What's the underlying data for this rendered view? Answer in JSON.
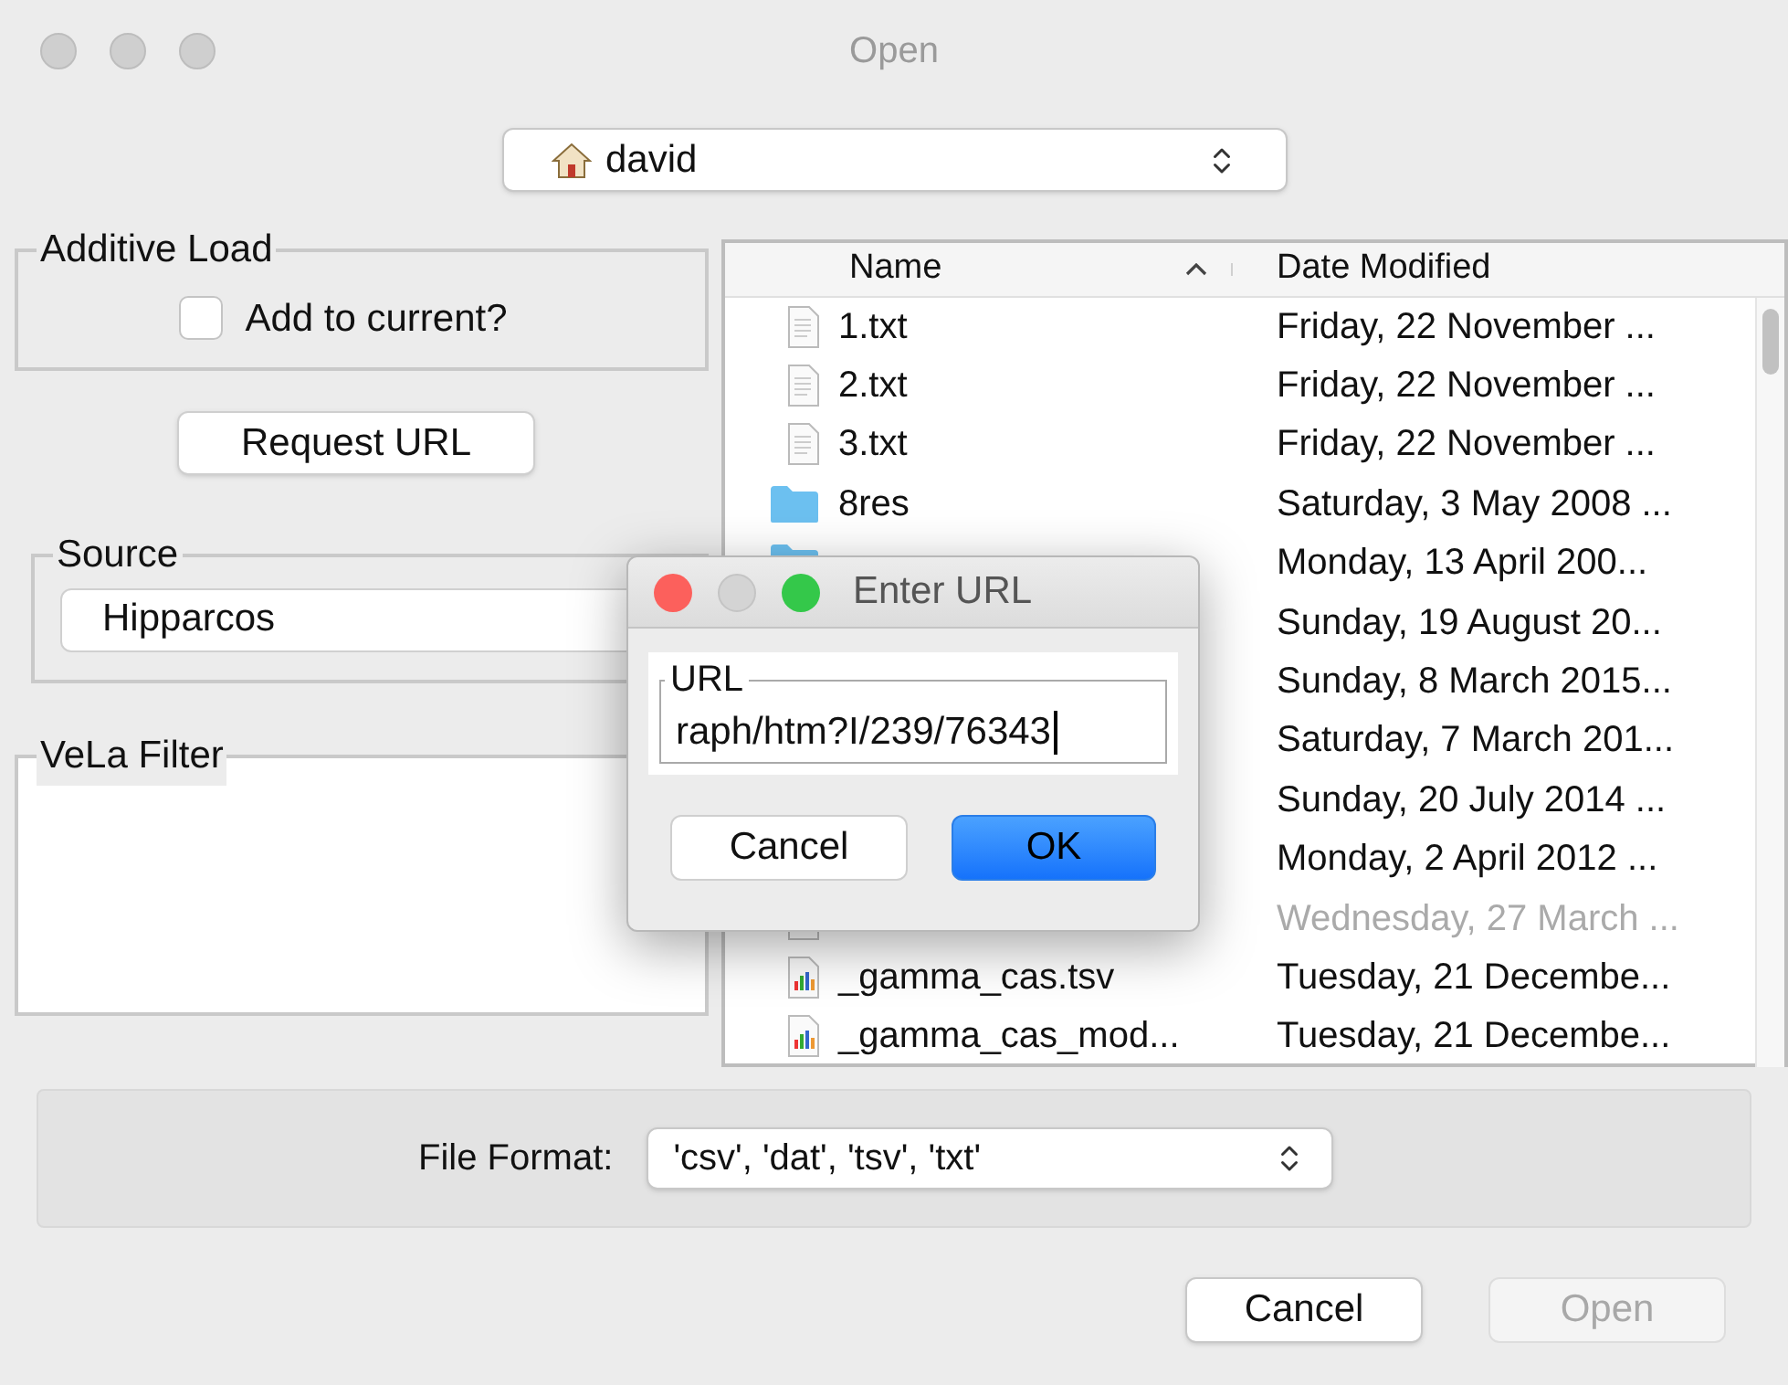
{
  "window": {
    "title": "Open"
  },
  "location": {
    "value": "david"
  },
  "additive_load": {
    "title": "Additive Load",
    "checkbox": {
      "label": "Add to current?",
      "checked": false
    }
  },
  "request_button": "Request URL",
  "source": {
    "title": "Source",
    "value": "Hipparcos"
  },
  "vela_filter": {
    "title": "VeLa Filter"
  },
  "file_list": {
    "columns": [
      {
        "label": "Name",
        "sorted_ascending": true
      },
      {
        "label": "Date Modified"
      }
    ],
    "rows": [
      {
        "kind": "text",
        "name": "1.txt",
        "date": "Friday, 22 November ...",
        "disabled": false
      },
      {
        "kind": "text",
        "name": "2.txt",
        "date": "Friday, 22 November ...",
        "disabled": false
      },
      {
        "kind": "text",
        "name": "3.txt",
        "date": "Friday, 22 November ...",
        "disabled": false
      },
      {
        "kind": "folder",
        "name": "8res",
        "date": "Saturday, 3 May 2008 ...",
        "disabled": false
      },
      {
        "kind": "folder",
        "date": "Monday, 13 April 200...",
        "disabled": false
      },
      {
        "date": "Sunday, 19 August 20...",
        "disabled": false
      },
      {
        "date": "Sunday, 8 March 2015...",
        "disabled": false
      },
      {
        "date": "Saturday, 7 March 201...",
        "disabled": false
      },
      {
        "date": "Sunday, 20 July 2014 ...",
        "disabled": false
      },
      {
        "date": "Monday, 2 April 2012 ...",
        "disabled": false
      },
      {
        "kind": "text",
        "date": "Wednesday, 27 March ...",
        "disabled": true
      },
      {
        "kind": "chart",
        "name": "_gamma_cas.tsv",
        "date": "Tuesday, 21 Decembe...",
        "disabled": false
      },
      {
        "kind": "chart",
        "name": "_gamma_cas_mod...",
        "date": "Tuesday, 21 Decembe...",
        "disabled": false
      }
    ]
  },
  "file_format": {
    "label": "File Format:",
    "value": "'csv', 'dat', 'tsv', 'txt'"
  },
  "buttons": [
    {
      "label": "Cancel",
      "disabled": false
    },
    {
      "label": "Open",
      "disabled": true
    }
  ],
  "url_dialog": {
    "title": "Enter URL",
    "field_label": "URL",
    "value": "raph/htm?I/239/76343",
    "buttons": [
      {
        "label": "Cancel",
        "default": false
      },
      {
        "label": "OK",
        "default": true
      }
    ]
  }
}
